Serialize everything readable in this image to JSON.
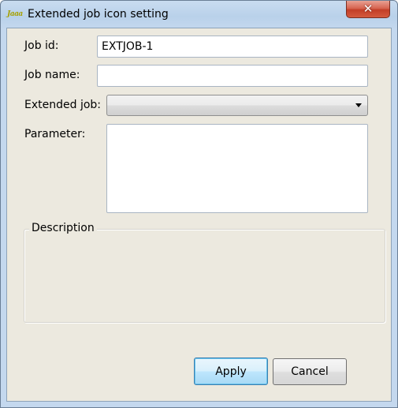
{
  "window": {
    "title": "Extended job icon setting",
    "app_icon_text": "Jaaa",
    "close_glyph": "✕"
  },
  "form": {
    "job_id": {
      "label": "Job id:",
      "value": "EXTJOB-1"
    },
    "job_name": {
      "label": "Job name:",
      "value": ""
    },
    "extended_job": {
      "label": "Extended job:",
      "selected": ""
    },
    "parameter": {
      "label": "Parameter:",
      "value": ""
    }
  },
  "description": {
    "title": "Description",
    "text": ""
  },
  "buttons": {
    "apply": "Apply",
    "cancel": "Cancel"
  }
}
